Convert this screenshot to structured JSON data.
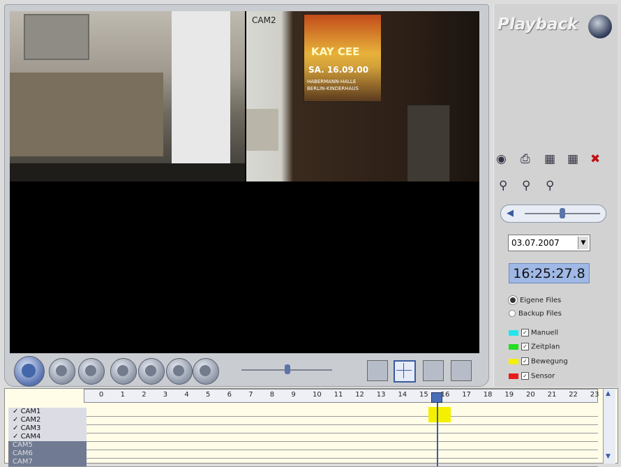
{
  "viewer": {
    "cam1_label": "",
    "cam2_label": "CAM2",
    "poster_lines": [
      "KAY CEE",
      "SA. 16.09.00",
      "HABERMANN-HALLE",
      "BERLIN-KINDERHAUS"
    ]
  },
  "panel": {
    "title": "Playback",
    "tool_icons": [
      "camera-icon",
      "printer-icon",
      "film-icon",
      "save-icon",
      "delete-icon"
    ],
    "zoom_icons": [
      "zoom-in-icon",
      "zoom-reset-icon",
      "zoom-out-icon"
    ],
    "date": "03.07.2007",
    "time": "16:25:27.8",
    "radio_options": [
      {
        "label": "Eigene Files",
        "selected": true
      },
      {
        "label": "Backup Files",
        "selected": false
      }
    ],
    "legend": [
      {
        "label": "Manuell",
        "color": "#22e5ee"
      },
      {
        "label": "Zeitplan",
        "color": "#22dd22"
      },
      {
        "label": "Bewegung",
        "color": "#f4f000"
      },
      {
        "label": "Sensor",
        "color": "#e81c1c"
      }
    ]
  },
  "controls": {
    "buttons": [
      "play-icon",
      "step-back-icon",
      "stop-icon",
      "rewind-icon",
      "prev-frame-icon",
      "next-frame-icon",
      "fast-forward-icon"
    ],
    "layouts": [
      "layout-1x1",
      "layout-2x2",
      "layout-3x3",
      "layout-4x4"
    ]
  },
  "timeline": {
    "hours": [
      "0",
      "1",
      "2",
      "3",
      "4",
      "5",
      "6",
      "7",
      "8",
      "9",
      "10",
      "11",
      "12",
      "13",
      "14",
      "15",
      "16",
      "17",
      "18",
      "19",
      "20",
      "21",
      "22",
      "23"
    ],
    "rows": [
      {
        "label": "CAM1",
        "checked": true
      },
      {
        "label": "CAM2",
        "checked": true
      },
      {
        "label": "CAM3",
        "checked": true
      },
      {
        "label": "CAM4",
        "checked": true
      },
      {
        "label": "CAM5",
        "checked": false
      },
      {
        "label": "CAM6",
        "checked": false
      },
      {
        "label": "CAM7",
        "checked": false
      }
    ]
  }
}
